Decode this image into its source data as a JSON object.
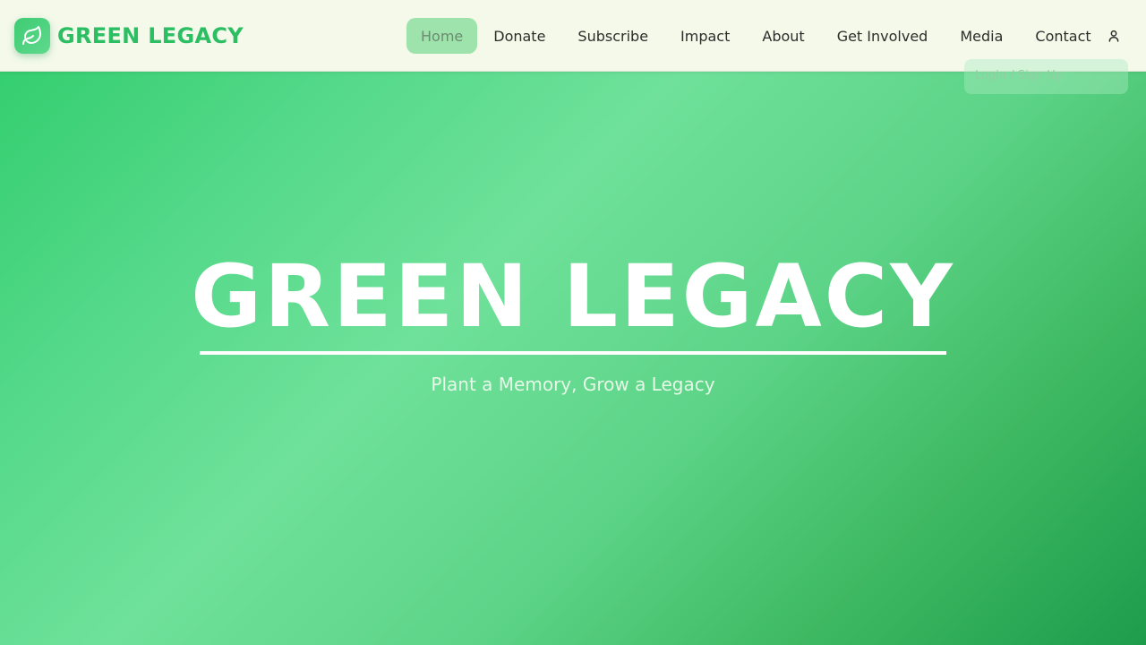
{
  "brand": {
    "name": "GREEN LEGACY",
    "logo_icon": "leaf-icon"
  },
  "nav": {
    "items": [
      {
        "label": "Home",
        "active": true
      },
      {
        "label": "Donate",
        "active": false
      },
      {
        "label": "Subscribe",
        "active": false
      },
      {
        "label": "Impact",
        "active": false
      },
      {
        "label": "About",
        "active": false
      },
      {
        "label": "Get Involved",
        "active": false
      },
      {
        "label": "Media",
        "active": false
      },
      {
        "label": "Contact",
        "active": false
      }
    ],
    "user_icon": "user-icon"
  },
  "user_menu": {
    "items": [
      {
        "label": "Login / Sign Up"
      }
    ]
  },
  "hero": {
    "title": "GREEN LEGACY",
    "tagline": "Plant a Memory, Grow a Legacy"
  },
  "colors": {
    "brand_green": "#2cbe63",
    "active_nav_bg": "#9ee3ab",
    "navbar_bg": "#f4f9ea"
  }
}
